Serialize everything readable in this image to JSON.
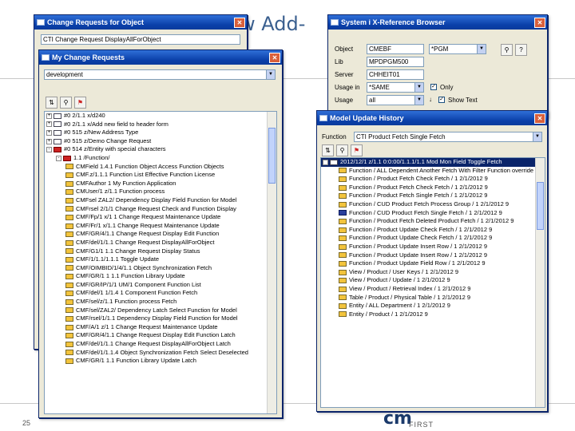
{
  "slide": {
    "title": "w Add-",
    "page_number": "25",
    "logo_main": "cm",
    "logo_sub": "FIRST"
  },
  "win_cr_object": {
    "title": "Change Requests for Object",
    "field_value": "CTI Change Request DisplayAllForObject"
  },
  "win_my_cr": {
    "title": "My Change Requests",
    "filter_value": "development",
    "toolbar": [
      {
        "name": "refresh-icon",
        "glyph": "⇅"
      },
      {
        "name": "find-icon",
        "glyph": "⚲"
      },
      {
        "name": "flag-icon",
        "glyph": "⚑"
      }
    ],
    "rows": [
      {
        "indent": 0,
        "pm": "+",
        "icon": "cr",
        "text": "#0 2/1.1 x/d240"
      },
      {
        "indent": 0,
        "pm": "+",
        "icon": "cr",
        "text": "#0 2/1.1 x/Add new field to header form"
      },
      {
        "indent": 0,
        "pm": "+",
        "icon": "cr",
        "text": "#0 515 z/New Address Type"
      },
      {
        "indent": 0,
        "pm": "+",
        "icon": "cr",
        "text": "#0 515 z/Demo Change Request"
      },
      {
        "indent": 0,
        "pm": "-",
        "icon": "cr-red",
        "text": "#0 514 z/Entity with special characters"
      },
      {
        "indent": 1,
        "pm": "-",
        "icon": "cr-red",
        "text": "1.1 /Function/"
      },
      {
        "indent": 2,
        "pm": "",
        "icon": "obj",
        "text": "CMField 1.4.1 Function Object Access Function Objects"
      },
      {
        "indent": 2,
        "pm": "",
        "icon": "obj",
        "text": "CMF.z/1.1.1 Function List Effective Function License"
      },
      {
        "indent": 2,
        "pm": "",
        "icon": "obj",
        "text": "CMFAuthor 1 My Function Application"
      },
      {
        "indent": 2,
        "pm": "",
        "icon": "obj",
        "text": "CMUser/1 z/1.1 Function process"
      },
      {
        "indent": 2,
        "pm": "",
        "icon": "obj",
        "text": "CMFsel ZAL2/ Dependency Display Field Function for Model"
      },
      {
        "indent": 2,
        "pm": "",
        "icon": "obj",
        "text": "CMFrsel 2/1/1 Change Request Check and Function Display"
      },
      {
        "indent": 2,
        "pm": "",
        "icon": "obj",
        "text": "CMF/Fp/1 x/1 1 Change Request Maintenance Update"
      },
      {
        "indent": 2,
        "pm": "",
        "icon": "obj",
        "text": "CMF/Fr/1 x/1.1 Change Request Maintenance Update"
      },
      {
        "indent": 2,
        "pm": "",
        "icon": "obj",
        "text": "CMF/GR/4/1.1 Change Request Display Edit Function"
      },
      {
        "indent": 2,
        "pm": "",
        "icon": "obj",
        "text": "CMF/del/1/1.1 Change Request DisplayAllForObject"
      },
      {
        "indent": 2,
        "pm": "",
        "icon": "obj",
        "text": "CMF/G1/1 1.1 Change Request Display Status"
      },
      {
        "indent": 2,
        "pm": "",
        "icon": "obj",
        "text": "CMF/1/1.1/1.1.1 Toggle Update"
      },
      {
        "indent": 2,
        "pm": "",
        "icon": "obj",
        "text": "CMF/OIMBID/1/4/1.1 Object Synchronization Fetch"
      },
      {
        "indent": 2,
        "pm": "",
        "icon": "obj",
        "text": "CMF/GR/1 1 1.1 Function Library Update"
      },
      {
        "indent": 2,
        "pm": "",
        "icon": "obj",
        "text": "CMF/GR/IP/1/1 UM/1 Component Function List"
      },
      {
        "indent": 2,
        "pm": "",
        "icon": "obj",
        "text": "CMF/del/1 1/1.4 1 Component Function Fetch"
      },
      {
        "indent": 2,
        "pm": "",
        "icon": "obj",
        "text": "CMF/sel/z/1.1 Function process Fetch"
      },
      {
        "indent": 2,
        "pm": "",
        "icon": "obj",
        "text": "CMF/sel/ZAL2/ Dependency Latch Select Function for Model"
      },
      {
        "indent": 2,
        "pm": "",
        "icon": "obj",
        "text": "CMF/rsel/1/1.1 Dependency Display Field Function for Model"
      },
      {
        "indent": 2,
        "pm": "",
        "icon": "obj",
        "text": "CMF/A/1 z/1 1 Change Request Maintenance Update"
      },
      {
        "indent": 2,
        "pm": "",
        "icon": "obj",
        "text": "CMF/GR/4/1.1 Change Request Display Edit Function Latch"
      },
      {
        "indent": 2,
        "pm": "",
        "icon": "obj",
        "text": "CMF/del/1/1.1 Change Request DisplayAllForObject Latch"
      },
      {
        "indent": 2,
        "pm": "",
        "icon": "obj",
        "text": "CMF/del/1/1.1.4 Object Synchronization Fetch Select Deselected"
      },
      {
        "indent": 2,
        "pm": "",
        "icon": "obj",
        "text": "CMF/GR/1 1.1 Function Library Update Latch"
      }
    ]
  },
  "win_xref": {
    "title": "System i X-Reference Browser",
    "fields": [
      {
        "label": "Object",
        "value": "CMEBF",
        "value2": "*PGM"
      },
      {
        "label": "Lib",
        "value": "MPDPGM500",
        "value2": ""
      },
      {
        "label": "Server",
        "value": "CHHEIT01",
        "value2": ""
      },
      {
        "label": "Usage in",
        "value": "*SAME",
        "value2": "Only"
      },
      {
        "label": "Usage",
        "value": "all",
        "value2": "Show Text"
      }
    ]
  },
  "win_update_history": {
    "title": "Model Update History",
    "function_label": "Function",
    "function_value": "CTI Product Fetch Single Fetch",
    "selected_row": "2012/12/1 z/1.1 0:0:00/1.1.1/1.1 Mod Mon Field Toggle Fetch",
    "rows": [
      {
        "icon": "obj",
        "text": "Function / ALL Dependent Another Fetch With Filter Function override"
      },
      {
        "icon": "obj",
        "text": "Function / Product Fetch Check Fetch / 1 2/1/2012 9"
      },
      {
        "icon": "obj",
        "text": "Function / Product Fetch Check Fetch / 1 2/1/2012 9"
      },
      {
        "icon": "obj",
        "text": "Function / Product Fetch Single Fetch / 1 2/1/2012 9"
      },
      {
        "icon": "obj",
        "text": "Function / CUD Product Fetch Process Group / 1 2/1/2012 9"
      },
      {
        "icon": "obj-blue",
        "text": "Function / CUD Product Fetch Single Fetch / 1 2/1/2012 9"
      },
      {
        "icon": "obj",
        "text": "Function / Product Fetch Deleted Product Fetch / 1 2/1/2012 9"
      },
      {
        "icon": "obj",
        "text": "Function / Product Update Check Fetch / 1 2/1/2012 9"
      },
      {
        "icon": "obj",
        "text": "Function / Product Update Check Fetch / 1 2/1/2012 9"
      },
      {
        "icon": "obj",
        "text": "Function / Product Update Insert Row / 1 2/1/2012 9"
      },
      {
        "icon": "obj",
        "text": "Function / Product Update Insert Row / 1 2/1/2012 9"
      },
      {
        "icon": "obj",
        "text": "Function / Product Update Field Row / 1 2/1/2012 9"
      },
      {
        "icon": "obj",
        "text": "View / Product / User Keys / 1 2/1/2012 9"
      },
      {
        "icon": "obj",
        "text": "View / Product / Update / 1 2/1/2012 9"
      },
      {
        "icon": "obj",
        "text": "View / Product / Retrieval Index / 1 2/1/2012 9"
      },
      {
        "icon": "obj",
        "text": "Table / Product / Physical Table / 1 2/1/2012 9"
      },
      {
        "icon": "obj",
        "text": "Entity / ALL Department / 1 2/1/2012 9"
      },
      {
        "icon": "obj",
        "text": "Entity / Product / 1 2/1/2012 9"
      }
    ]
  }
}
